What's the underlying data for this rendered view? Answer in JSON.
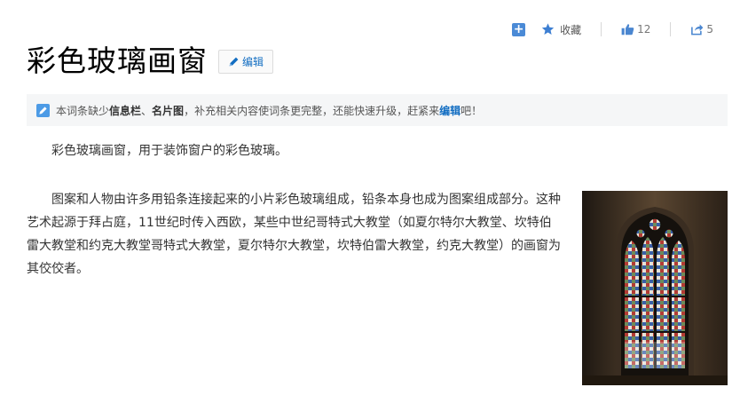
{
  "toolbar": {
    "add_icon": "plus-square-icon",
    "favorite_label": "收藏",
    "like_count": "12",
    "share_count": "5",
    "accent_color": "#4a8ad6"
  },
  "header": {
    "title": "彩色玻璃画窗",
    "edit_label": "编辑"
  },
  "notice": {
    "prefix": "本词条缺少",
    "missing_1": "信息栏",
    "sep": "、",
    "missing_2": "名片图",
    "middle": "，补充相关内容使词条更完整，还能快速升级，赶紧来",
    "link": "编辑",
    "suffix": "吧！"
  },
  "content": {
    "paragraph_1": "彩色玻璃画窗，用于装饰窗户的彩色玻璃。",
    "paragraph_2": "图案和人物由许多用铅条连接起来的小片彩色玻璃组成，铅条本身也成为图案组成部分。这种艺术起源于拜占庭，11世纪时传入西欧，某些中世纪哥特式大教堂（如夏尔特尔大教堂、坎特伯雷大教堂和约克大教堂哥特式大教堂，夏尔特尔大教堂，坎特伯雷大教堂，约克大教堂）的画窗为其佼佼者。"
  }
}
